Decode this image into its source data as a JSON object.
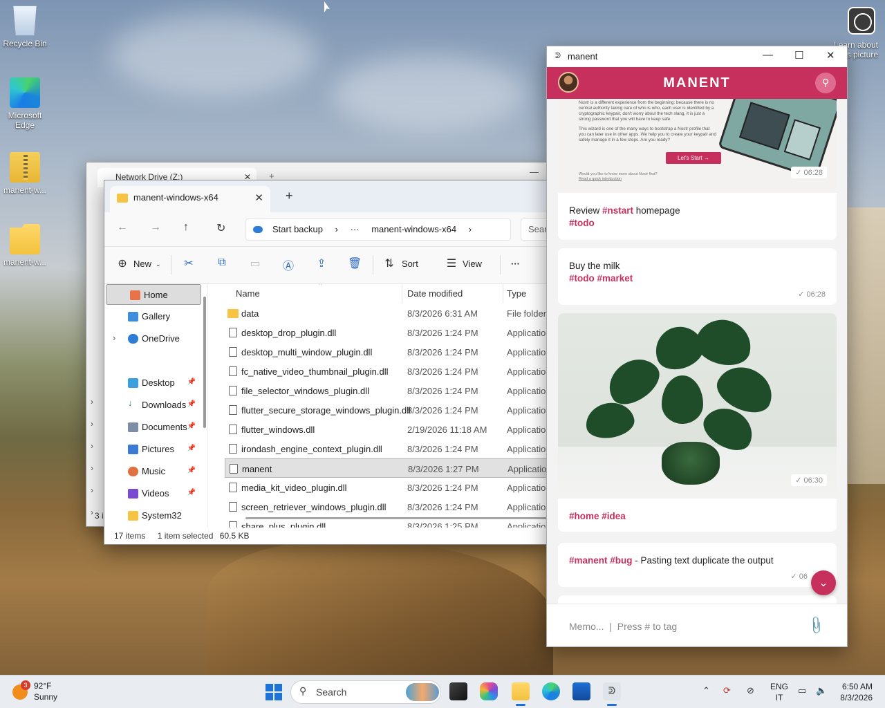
{
  "desktop": {
    "icons": [
      {
        "label": "Recycle Bin"
      },
      {
        "label": "Microsoft Edge"
      },
      {
        "label": "manent-w..."
      },
      {
        "label": "manent-w..."
      }
    ],
    "learn_label": "Learn about this picture"
  },
  "back_window": {
    "tab_title": "Network Drive (Z:)",
    "status": "3 i"
  },
  "explorer": {
    "tab_title": "manent-windows-x64",
    "breadcrumb": {
      "backup": "Start backup",
      "more": "···",
      "folder": "manent-windows-x64"
    },
    "search_placeholder": "Sear",
    "toolbar": {
      "new": "New",
      "sort": "Sort",
      "view": "View",
      "more": "···"
    },
    "nav": [
      {
        "label": "Home",
        "color": "#e8734a"
      },
      {
        "label": "Gallery",
        "color": "#3f8ede"
      },
      {
        "label": "OneDrive",
        "color": "#2d7dd6"
      },
      {
        "label": "Desktop",
        "color": "#3aa0e0"
      },
      {
        "label": "Downloads",
        "color": "#3b8a6e"
      },
      {
        "label": "Documents",
        "color": "#7d8ea7"
      },
      {
        "label": "Pictures",
        "color": "#3b7bd4"
      },
      {
        "label": "Music",
        "color": "#e07040"
      },
      {
        "label": "Videos",
        "color": "#7a4bd0"
      },
      {
        "label": "System32",
        "color": "#f6c343"
      }
    ],
    "columns": {
      "name": "Name",
      "date": "Date modified",
      "type": "Type"
    },
    "files": [
      {
        "name": "data",
        "date": "8/3/2026 6:31 AM",
        "type": "File folder"
      },
      {
        "name": "desktop_drop_plugin.dll",
        "date": "8/3/2026 1:24 PM",
        "type": "Application"
      },
      {
        "name": "desktop_multi_window_plugin.dll",
        "date": "8/3/2026 1:24 PM",
        "type": "Application"
      },
      {
        "name": "fc_native_video_thumbnail_plugin.dll",
        "date": "8/3/2026 1:24 PM",
        "type": "Application"
      },
      {
        "name": "file_selector_windows_plugin.dll",
        "date": "8/3/2026 1:24 PM",
        "type": "Application"
      },
      {
        "name": "flutter_secure_storage_windows_plugin.dll",
        "date": "8/3/2026 1:24 PM",
        "type": "Application"
      },
      {
        "name": "flutter_windows.dll",
        "date": "2/19/2026 11:18 AM",
        "type": "Application"
      },
      {
        "name": "irondash_engine_context_plugin.dll",
        "date": "8/3/2026 1:24 PM",
        "type": "Application"
      },
      {
        "name": "manent",
        "date": "8/3/2026 1:27 PM",
        "type": "Application"
      },
      {
        "name": "media_kit_video_plugin.dll",
        "date": "8/3/2026 1:24 PM",
        "type": "Application"
      },
      {
        "name": "screen_retriever_windows_plugin.dll",
        "date": "8/3/2026 1:24 PM",
        "type": "Application"
      },
      {
        "name": "share_plus_plugin.dll",
        "date": "8/3/2026 1:25 PM",
        "type": "Application"
      }
    ],
    "status": {
      "items": "17 items",
      "selected": "1 item selected",
      "size": "60.5 KB"
    }
  },
  "manent": {
    "window_title": "manent",
    "brand": "MANENT",
    "promo": {
      "text": "Nostr is a different experience from the beginning: because there is no central authority taking care of who is who, each user is identified by a cryptographic keypair; don't worry about the tech slang, it is just a strong password that you will have to keep safe.",
      "text2": "This wizard is one of the many ways to bootstrap a Nostr profile that you can later use in other apps. We help you to create your keypair and safely manage it in a few steps. Are you ready?",
      "button": "Let's Start →",
      "footer": "Would you like to know more about Nostr first?",
      "footer_link": "Read a quick introduction",
      "time": "06:28"
    },
    "notes": [
      {
        "pre": "Review ",
        "tag1": "#nstart",
        "mid": " homepage",
        "tag2": "#todo"
      },
      {
        "pre": "Buy the milk",
        "tag1": "#todo",
        "tag2": "#market",
        "time": "06:28"
      }
    ],
    "photo": {
      "time": "06:30",
      "tags": "#home #idea"
    },
    "bug_note": {
      "tag1": "#manent",
      "tag2": "#bug",
      "text": " - Pasting text duplicate the output",
      "time": "06"
    },
    "input_placeholder": "Memo...  |  Press # to tag",
    "accent": "#c7305c"
  },
  "taskbar": {
    "weather": {
      "badge": "3",
      "temp": "92°F",
      "condition": "Sunny"
    },
    "search": "Search",
    "lang": {
      "line1": "ENG",
      "line2": "IT"
    },
    "clock": {
      "time": "6:50 AM",
      "date": "8/3/2026"
    }
  }
}
